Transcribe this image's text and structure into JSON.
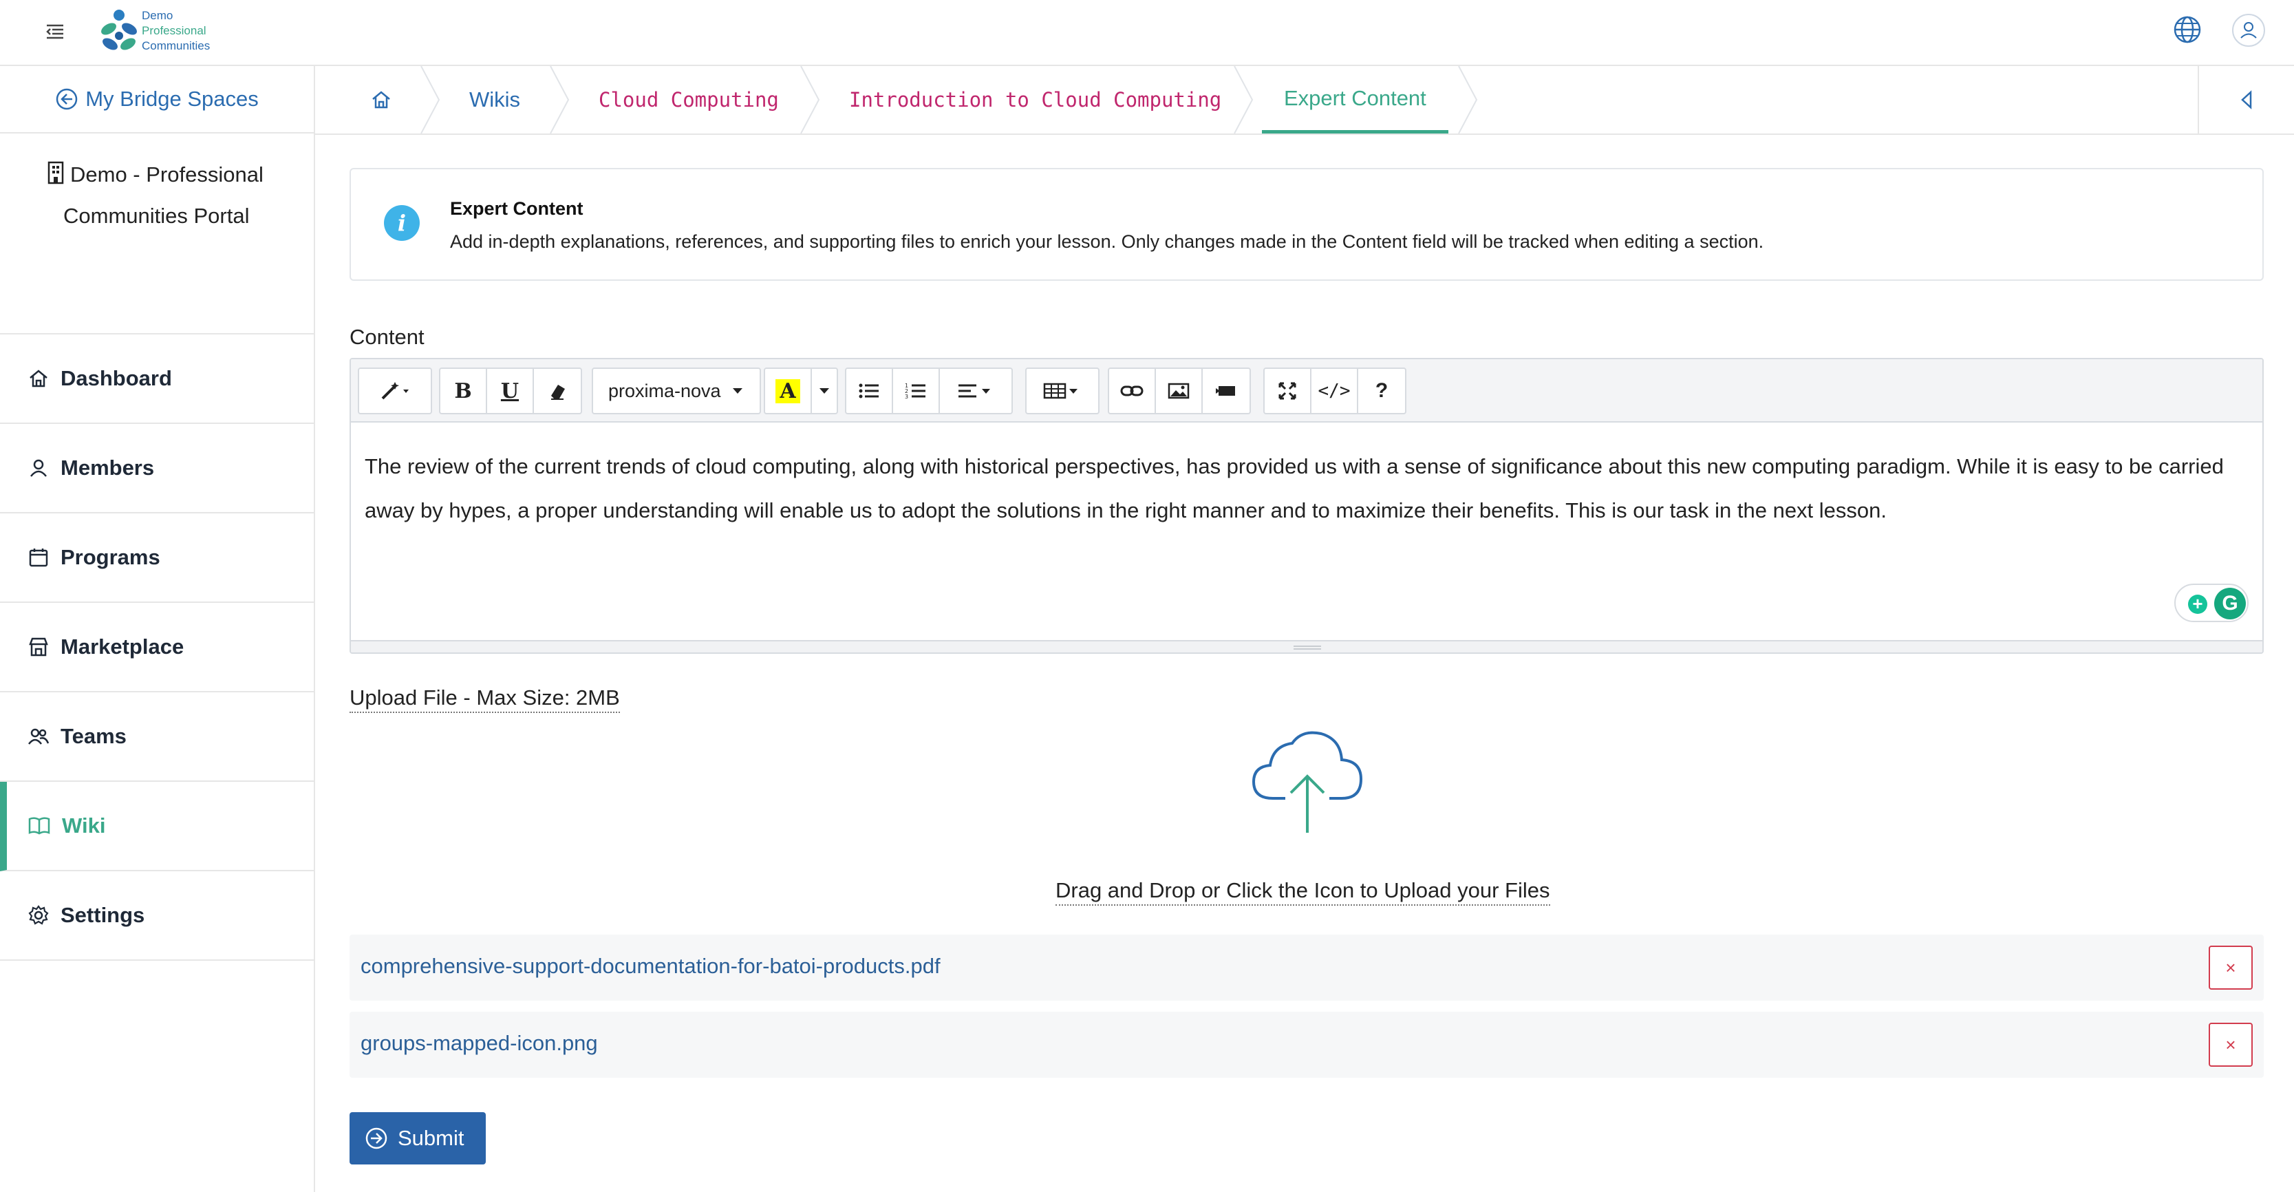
{
  "brand": {
    "logo_lines": [
      "Demo",
      "Professional",
      "Communities"
    ],
    "accent": "#3aa88a",
    "primary": "#2a63a8"
  },
  "topbar": {
    "menu_icon": "hamburger-icon",
    "language_icon": "globe-icon",
    "user_icon": "user-icon"
  },
  "sidebar": {
    "back_label": "My Bridge Spaces",
    "org_line1": "Demo - Professional",
    "org_line2": "Communities Portal",
    "items": [
      {
        "label": "Dashboard",
        "icon": "home-icon"
      },
      {
        "label": "Members",
        "icon": "person-icon"
      },
      {
        "label": "Programs",
        "icon": "calendar-icon"
      },
      {
        "label": "Marketplace",
        "icon": "store-icon"
      },
      {
        "label": "Teams",
        "icon": "people-icon"
      },
      {
        "label": "Wiki",
        "icon": "book-icon",
        "active": true
      },
      {
        "label": "Settings",
        "icon": "gear-icon"
      }
    ]
  },
  "breadcrumb": {
    "home_icon": "home-icon",
    "items": [
      "Wikis",
      "Cloud Computing",
      "Introduction to Cloud Computing",
      "Expert Content"
    ]
  },
  "info": {
    "title": "Expert Content",
    "description": "Add in-depth explanations, references, and supporting files to enrich your lesson. Only changes made in the Content field will be tracked when editing a section."
  },
  "editor": {
    "label": "Content",
    "font": "proxima-nova",
    "text": "The review of the current trends of cloud computing, along with historical perspectives, has provided us with a sense of significance about this new computing paradigm. While it is easy to be carried away by hypes, a proper understanding will enable us to adopt the solutions in the right manner and to maximize their benefits. This is our task in the next lesson.",
    "toolbar": {
      "bold": "B",
      "underline": "U",
      "highlight": "A",
      "help": "?",
      "code": "</>"
    }
  },
  "upload": {
    "label": "Upload File - Max Size: 2MB",
    "drop_text": "Drag and Drop or Click the Icon to Upload your Files",
    "files": [
      {
        "name": "comprehensive-support-documentation-for-batoi-products.pdf",
        "remove": "×"
      },
      {
        "name": "groups-mapped-icon.png",
        "remove": "×"
      }
    ]
  },
  "submit_label": "Submit"
}
